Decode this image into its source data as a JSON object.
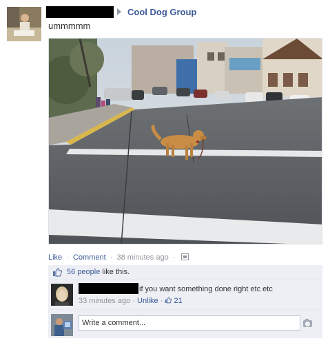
{
  "post": {
    "group_name": "Cool Dog Group",
    "text": "ummmmm"
  },
  "actions": {
    "like": "Like",
    "dot1": "·",
    "comment": "Comment",
    "dot2": "·",
    "time": "38 minutes ago",
    "dot3": "·",
    "share_icon": "audience-icon"
  },
  "likes": {
    "icon": "thumbs-up-icon",
    "people": "56 people",
    "suffix": " like this."
  },
  "comment": {
    "text": "if you want something done right etc etc",
    "time": "33 minutes ago",
    "dot1": "·",
    "unlike": "Unlike",
    "dot2": "·",
    "like_count": "21"
  },
  "write": {
    "placeholder": "Write a comment...",
    "camera_icon": "camera-icon"
  },
  "colors": {
    "link": "#3b5998",
    "meta": "#90949c",
    "ufi_bg": "#edeff4"
  }
}
